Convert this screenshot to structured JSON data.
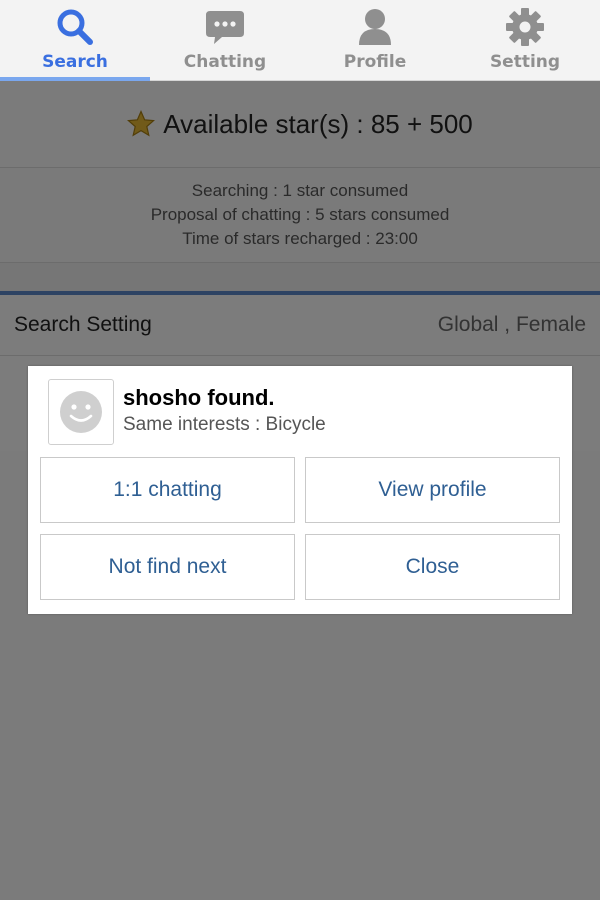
{
  "tabs": [
    {
      "label": "Search",
      "icon": "search-icon",
      "active": true
    },
    {
      "label": "Chatting",
      "icon": "chat-bubble-icon",
      "active": false
    },
    {
      "label": "Profile",
      "icon": "person-icon",
      "active": false
    },
    {
      "label": "Setting",
      "icon": "gear-icon",
      "active": false
    }
  ],
  "stars": {
    "text": "Available star(s) : 85 + 500",
    "icon": "star-icon",
    "icon_color": "#c9a227"
  },
  "info": {
    "line1": "Searching : 1 star consumed",
    "line2": "Proposal of chatting : 5 stars consumed",
    "line3": "Time of stars recharged : 23:00"
  },
  "search_setting": {
    "label": "Search Setting",
    "value": "Global , Female"
  },
  "dialog": {
    "title": "shosho found.",
    "interests": "Same interests : Bicycle",
    "avatar_icon": "smiley-face-icon",
    "buttons": {
      "chat": "1:1 chatting",
      "view_profile": "View profile",
      "not_find_next": "Not find next",
      "close": "Close"
    }
  },
  "colors": {
    "active_tab": "#3a6fe0",
    "inactive_tab": "#8f8f8f",
    "button_text": "#2f5f93",
    "accent_divider": "#5b87c7"
  }
}
